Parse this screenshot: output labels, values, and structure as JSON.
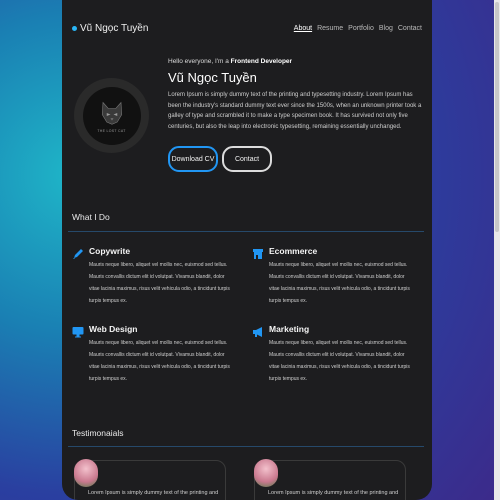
{
  "nav": {
    "brand": "Vũ Ngọc Tuyền",
    "items": [
      "About",
      "Resume",
      "Portfolio",
      "Blog",
      "Contact"
    ],
    "active": "About"
  },
  "hero": {
    "greeting": "Hello everyone, I'm a ",
    "role": "Frontend Developer",
    "name": "Vũ Ngọc Tuyền",
    "bio": "Lorem Ipsum is simply dummy text of the printing and typesetting industry. Lorem Ipsum has been the industry's standard dummy text ever since the 1500s, when an unknown printer took a galley of type and scrambled it to make a type specimen book. It has survived not only five centuries, but also the leap into electronic typesetting, remaining essentially unchanged.",
    "avatar_caption": "THE LOST CAT",
    "download_label": "Download CV",
    "contact_label": "Contact"
  },
  "services": {
    "heading": "What I Do",
    "items": [
      {
        "title": "Copywrite",
        "icon": "pencil-icon",
        "desc": "Mauris neque libero, aliquet vel mollis nec, euismod sed tellus. Mauris convallis dictum elit id volutpat. Vivamus blandit, dolor vitae lacinia maximus, risus velit vehicula odio, a tincidunt turpis turpis tempus ex."
      },
      {
        "title": "Ecommerce",
        "icon": "store-icon",
        "desc": "Mauris neque libero, aliquet vel mollis nec, euismod sed tellus. Mauris convallis dictum elit id volutpat. Vivamus blandit, dolor vitae lacinia maximus, risus velit vehicula odio, a tincidunt turpis turpis tempus ex."
      },
      {
        "title": "Web Design",
        "icon": "monitor-icon",
        "desc": "Mauris neque libero, aliquet vel mollis nec, euismod sed tellus. Mauris convallis dictum elit id volutpat. Vivamus blandit, dolor vitae lacinia maximus, risus velit vehicula odio, a tincidunt turpis turpis tempus ex."
      },
      {
        "title": "Marketing",
        "icon": "megaphone-icon",
        "desc": "Mauris neque libero, aliquet vel mollis nec, euismod sed tellus. Mauris convallis dictum elit id volutpat. Vivamus blandit, dolor vitae lacinia maximus, risus velit vehicula odio, a tincidunt turpis turpis tempus ex."
      }
    ]
  },
  "testimonials": {
    "heading": "Testimonaials",
    "items": [
      {
        "text": "Lorem Ipsum is simply dummy text of the printing and"
      },
      {
        "text": "Lorem Ipsum is simply dummy text of the printing and"
      }
    ]
  },
  "colors": {
    "accent": "#2196f3",
    "card_bg": "#1d1d1f"
  }
}
